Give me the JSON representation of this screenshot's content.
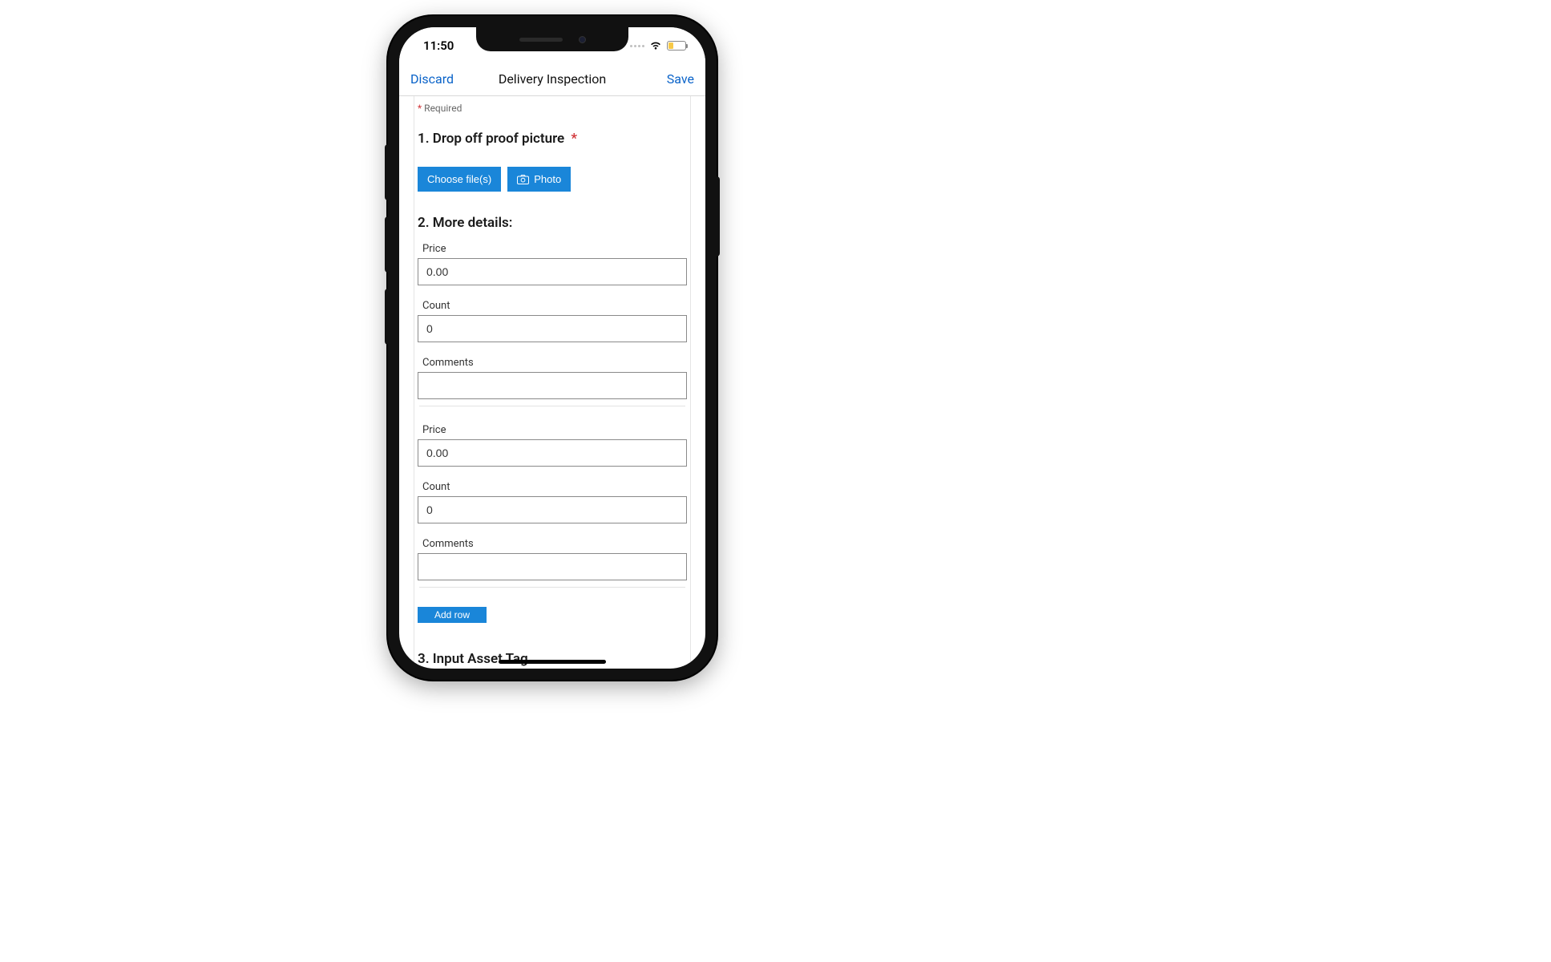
{
  "status": {
    "time": "11:50"
  },
  "nav": {
    "discard": "Discard",
    "title": "Delivery Inspection",
    "save": "Save"
  },
  "required_label": "Required",
  "q1": {
    "number": "1.",
    "label": "Drop off proof picture",
    "choose_files": "Choose file(s)",
    "photo": "Photo"
  },
  "q2": {
    "number": "2.",
    "label": "More details:",
    "price_label": "Price",
    "count_label": "Count",
    "comments_label": "Comments",
    "rows": [
      {
        "price": "0.00",
        "count": "0",
        "comments": ""
      },
      {
        "price": "0.00",
        "count": "0",
        "comments": ""
      }
    ],
    "add_row": "Add row"
  },
  "q3": {
    "number": "3.",
    "label": "Input Asset Tag",
    "value": ""
  }
}
